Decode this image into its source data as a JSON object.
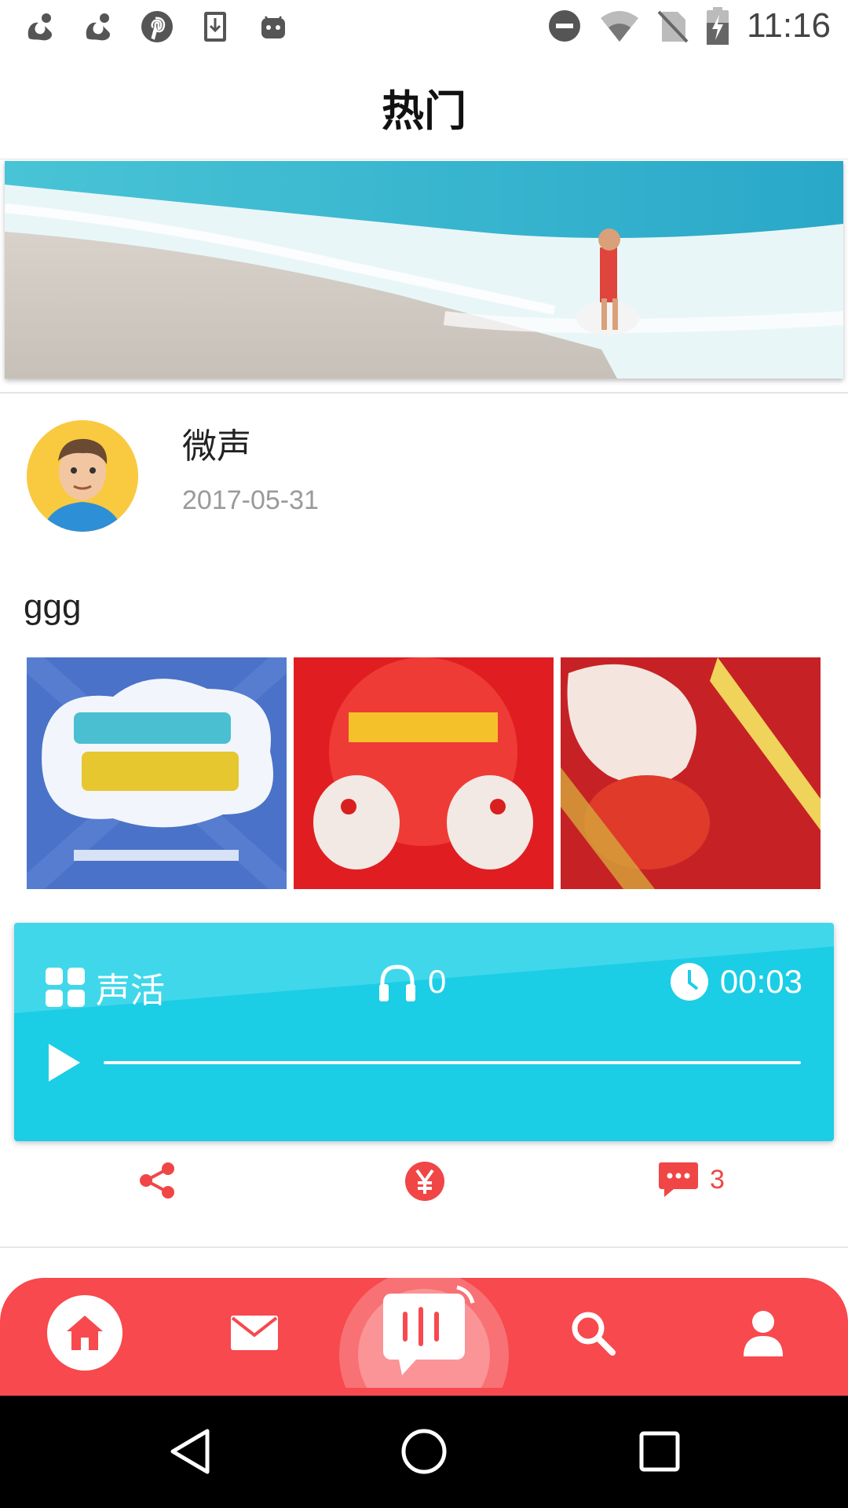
{
  "status_bar": {
    "time": "11:16",
    "left_icons": [
      "uc-browser-icon",
      "uc-browser-icon",
      "pinterest-icon",
      "download-icon",
      "android-icon"
    ],
    "right_icons": [
      "dnd-icon",
      "wifi-icon",
      "no-sim-icon",
      "battery-charging-icon"
    ]
  },
  "header": {
    "title": "热门"
  },
  "post": {
    "author": "微声",
    "date": "2017-05-31",
    "text": "ggg",
    "images": [
      "image-1",
      "image-2",
      "image-3"
    ],
    "audio": {
      "category": "声活",
      "listens": "0",
      "duration": "00:03",
      "progress": 0
    },
    "actions": {
      "comment_count": "3"
    }
  },
  "bottom_nav": {
    "items": [
      "home",
      "messages",
      "record",
      "search",
      "profile"
    ],
    "active": "home"
  },
  "colors": {
    "accent": "#f7494e",
    "audio_card": "#1ccde6",
    "action_red": "#f04646"
  }
}
